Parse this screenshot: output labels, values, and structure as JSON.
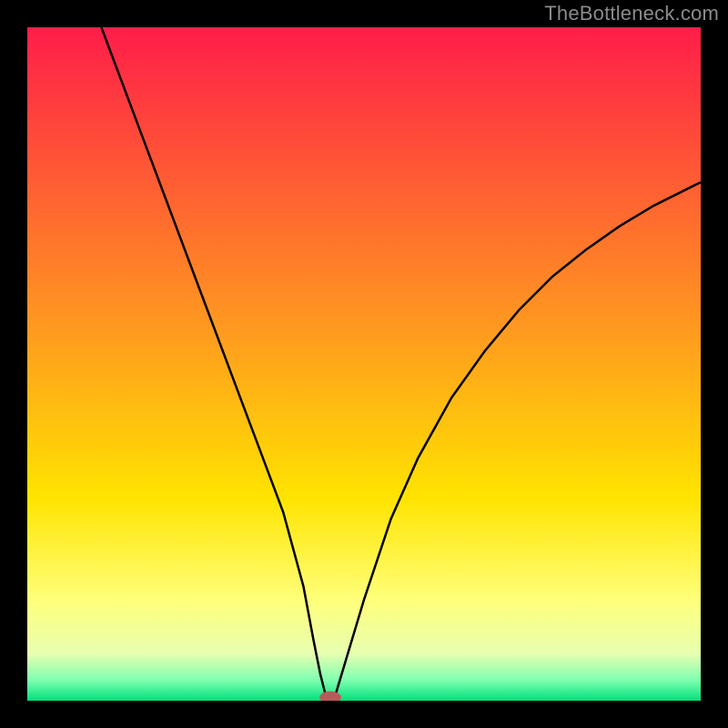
{
  "watermark": "TheBottleneck.com",
  "chart_data": {
    "type": "line",
    "title": "",
    "xlabel": "",
    "ylabel": "",
    "xlim": [
      0,
      100
    ],
    "ylim": [
      0,
      100
    ],
    "background_gradient": {
      "stops": [
        {
          "offset": 0.0,
          "color": "#ff1d49"
        },
        {
          "offset": 0.45,
          "color": "#ff9a1f"
        },
        {
          "offset": 0.7,
          "color": "#ffe400"
        },
        {
          "offset": 0.85,
          "color": "#ffff7a"
        },
        {
          "offset": 0.93,
          "color": "#e8ffb0"
        },
        {
          "offset": 0.97,
          "color": "#7dffb0"
        },
        {
          "offset": 1.0,
          "color": "#00e07a"
        }
      ]
    },
    "series": [
      {
        "name": "bottleneck-curve",
        "color": "#000000",
        "x": [
          11,
          14,
          17,
          20,
          23,
          26,
          29,
          32,
          35,
          38,
          41,
          42.5,
          43.5,
          44.5,
          45.5,
          47,
          50,
          54,
          58,
          63,
          68,
          73,
          78,
          83,
          88,
          93,
          98,
          100
        ],
        "values": [
          100,
          92,
          84,
          76,
          68,
          60,
          52,
          44,
          36,
          28,
          17,
          9,
          4,
          0,
          0,
          5,
          15,
          27,
          36,
          45,
          52,
          58,
          63,
          67,
          70.5,
          73.5,
          76,
          77
        ]
      }
    ],
    "marker": {
      "name": "optimal-point",
      "x": 45,
      "y": 0.5,
      "color": "#b85a5a",
      "rx": 1.6,
      "ry": 0.9
    }
  }
}
